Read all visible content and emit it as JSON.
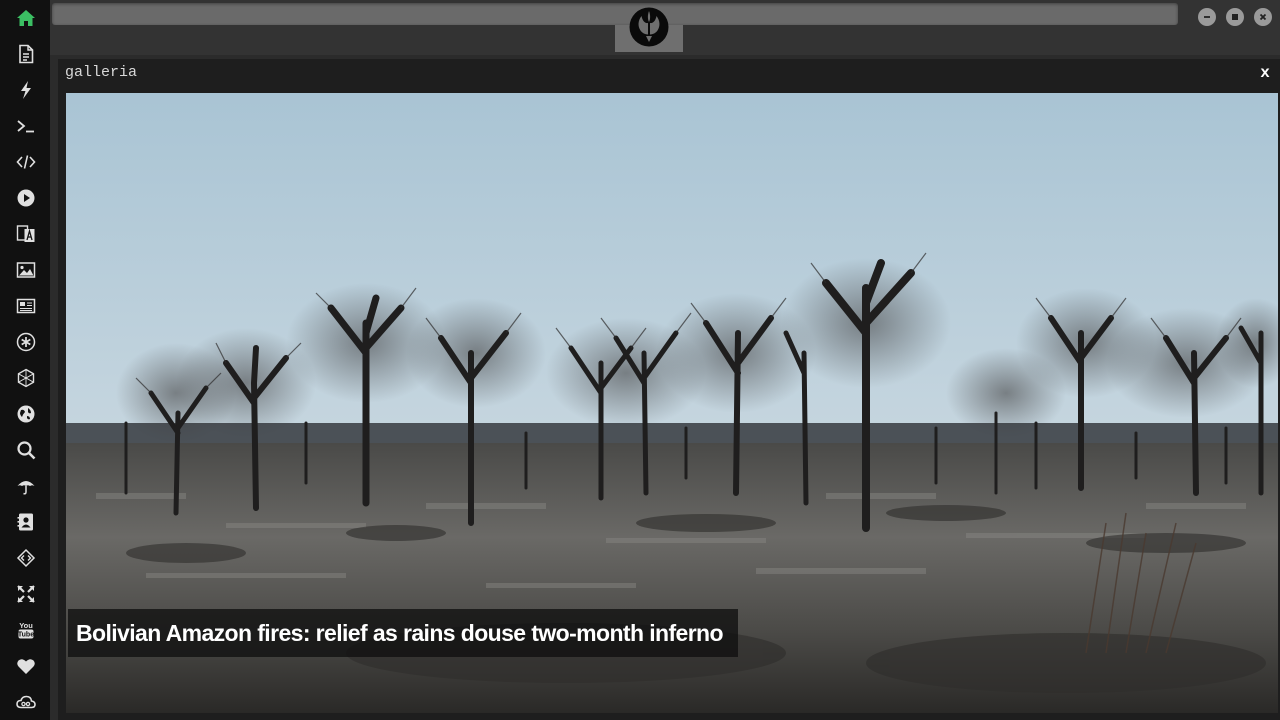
{
  "app": {
    "brand_icon": "rebel-alliance-logo",
    "accent_color": "#3bbf63"
  },
  "sidebar": {
    "items": [
      {
        "icon": "home-icon",
        "active": true
      },
      {
        "icon": "document-icon"
      },
      {
        "icon": "lightning-icon"
      },
      {
        "icon": "terminal-icon"
      },
      {
        "icon": "code-icon"
      },
      {
        "icon": "play-icon"
      },
      {
        "icon": "translate-icon"
      },
      {
        "icon": "image-icon"
      },
      {
        "icon": "newspaper-icon"
      },
      {
        "icon": "asterisk-icon"
      },
      {
        "icon": "hexagon-icon"
      },
      {
        "icon": "globe-icon"
      },
      {
        "icon": "search-icon"
      },
      {
        "icon": "umbrella-icon"
      },
      {
        "icon": "contact-card-icon"
      },
      {
        "icon": "tag-code-icon"
      },
      {
        "icon": "expand-icon"
      },
      {
        "icon": "youtube-icon"
      },
      {
        "icon": "heart-icon"
      },
      {
        "icon": "cloud-icon"
      }
    ]
  },
  "window_controls": [
    "minimize-icon",
    "maximize-icon",
    "close-icon"
  ],
  "panel": {
    "title": "galleria",
    "close_label": "x"
  },
  "gallery": {
    "caption": "Bolivian Amazon fires: relief as rains douse two-month inferno"
  }
}
